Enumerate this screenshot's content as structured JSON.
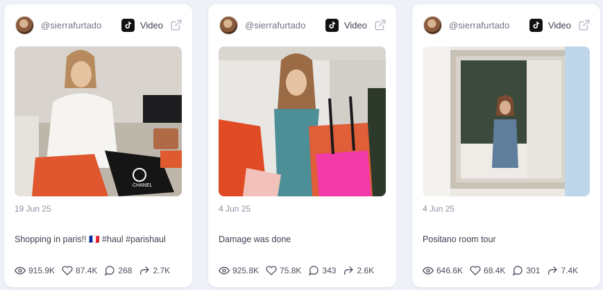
{
  "posts": [
    {
      "username": "@sierrafurtado",
      "platform_icon": "tiktok-icon",
      "type_label": "Video",
      "date": "19 Jun 25",
      "caption": "Shopping in paris!! 🇫🇷 #haul #parishaul",
      "stats": {
        "views": "915.9K",
        "likes": "87.4K",
        "comments": "268",
        "shares": "2.7K"
      }
    },
    {
      "username": "@sierrafurtado",
      "platform_icon": "tiktok-icon",
      "type_label": "Video",
      "date": "4 Jun 25",
      "caption": "Damage was done",
      "stats": {
        "views": "925.8K",
        "likes": "75.8K",
        "comments": "343",
        "shares": "2.6K"
      }
    },
    {
      "username": "@sierrafurtado",
      "platform_icon": "tiktok-icon",
      "type_label": "Video",
      "date": "4 Jun 25",
      "caption": "Positano room tour",
      "stats": {
        "views": "646.6K",
        "likes": "68.4K",
        "comments": "301",
        "shares": "7.4K"
      }
    }
  ],
  "thumbnail_labels": {
    "bag_brand": "CHANEL"
  }
}
